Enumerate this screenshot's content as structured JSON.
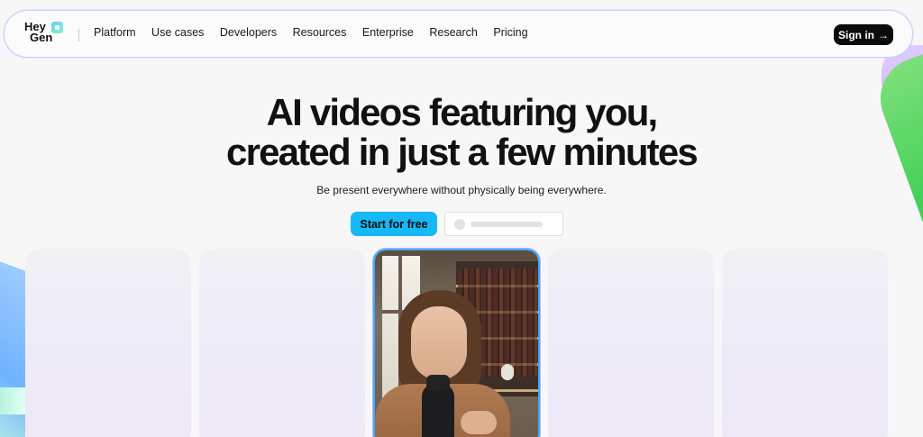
{
  "nav": {
    "logo_line1": "Hey",
    "logo_line2": "Gen",
    "links": [
      "Platform",
      "Use cases",
      "Developers",
      "Resources",
      "Enterprise",
      "Research",
      "Pricing"
    ],
    "signin_label": "Sign in",
    "signin_icon": "arrow-right-icon"
  },
  "hero": {
    "title_line1": "AI videos featuring you,",
    "title_line2": "created in just a few minutes",
    "subtitle": "Be present everywhere without physically being everywhere.",
    "cta_primary": "Start for free"
  },
  "colors": {
    "accent": "#16b8f5",
    "signin_bg": "#0b0b0d",
    "nav_border": "#b9d9f7"
  }
}
